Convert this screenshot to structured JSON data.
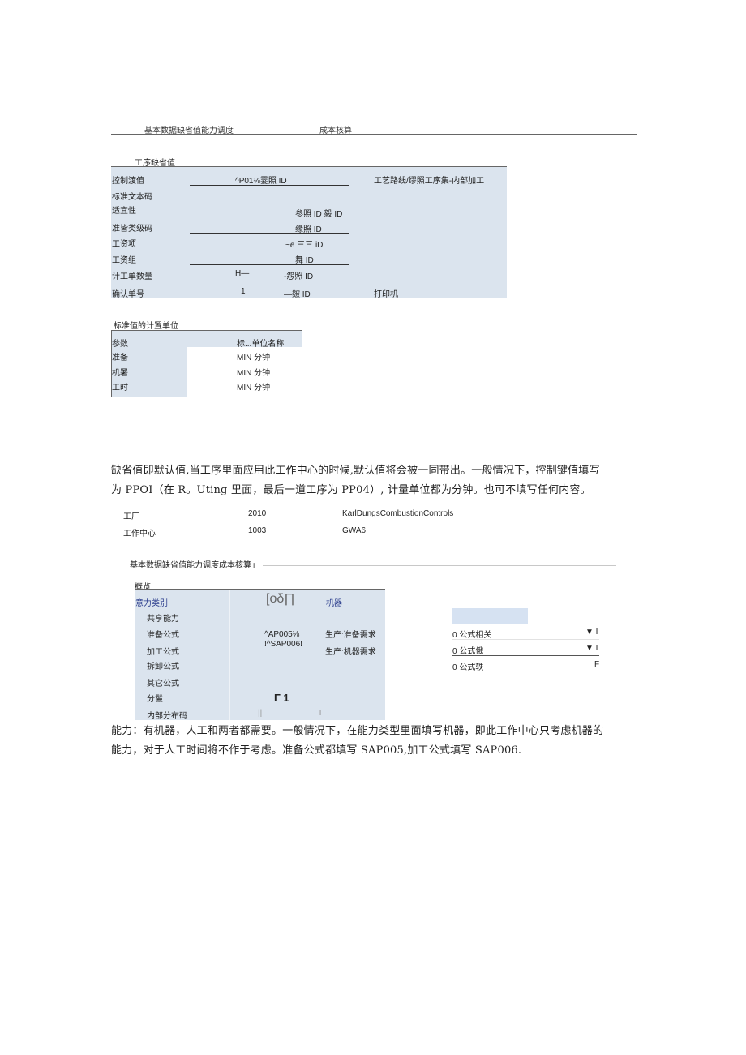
{
  "top_tabs": {
    "tab1": "基本数据缺省值能力调度",
    "tab2": "成本核算"
  },
  "operation_defaults": {
    "section_title": "工序缺省值",
    "rows": [
      {
        "label": "控制渡值",
        "value": "^P01⅛霎照 ID",
        "right": "工艺路线/缪照工序集-内部加工"
      },
      {
        "label": "标准文本码",
        "value": "",
        "right": ""
      },
      {
        "label": "适宜性",
        "value": "参照 ID 毅 ID",
        "right": ""
      },
      {
        "label": "准皆类级码",
        "value": "缘照 ID",
        "right": ""
      },
      {
        "label": "工资项",
        "value": "~e 三三 iD",
        "right": ""
      },
      {
        "label": "工资组",
        "value": "舞 ID",
        "right": ""
      },
      {
        "label": "计工单数量",
        "value_a": "H—",
        "value": "-怨照 ID",
        "right": ""
      },
      {
        "label": "确认单号",
        "value_a": "1",
        "value": "—皴 ID",
        "right": "打印机"
      }
    ]
  },
  "units_table": {
    "section_title": "标准值的计置单位",
    "headers": [
      "参数",
      "标...单位名称"
    ],
    "rows": [
      {
        "param": "准备",
        "unit": "MIN 分钟"
      },
      {
        "param": "机署",
        "unit": "MIN 分钟"
      },
      {
        "param": "工时",
        "unit": "MIN 分钟"
      }
    ]
  },
  "paragraph1": {
    "line1": "缺省值即默认值,当工序里面应用此工作中心的时候,默认值将会被一同带出。一般情况下，控制键值填写",
    "line2": "为 PPOI（在 R。Uting 里面，最后一道工序为 PP04）, 计量单位都为分钟。也可不填写任何内容。"
  },
  "header_info": {
    "plant_label": "工厂",
    "plant_code": "2010",
    "plant_name": "KarlDungsCombustionControls",
    "wc_label": "工作中心",
    "wc_code": "1003",
    "wc_name": "GWA6"
  },
  "tabs2": {
    "label": "基本数据缺省值能力调度成本核算」"
  },
  "overview": {
    "section_title": "概览",
    "capacity_type_label": "意力类别",
    "capacity_type_code": "[oδ∏",
    "capacity_type_value": "机器",
    "rows": [
      {
        "label": "共享能力",
        "value": "",
        "desc": ""
      },
      {
        "label": "准备公式",
        "value": "^AP005⅛",
        "desc": "生产:准备需求"
      },
      {
        "label": "加工公式",
        "value": "!^SAP006!",
        "desc": "生产:机器需求"
      },
      {
        "label": "拆卸公式",
        "value": "",
        "desc": ""
      },
      {
        "label": "其它公式",
        "value": "",
        "desc": ""
      },
      {
        "label": "分鬣",
        "value": "Γ 1",
        "desc": ""
      },
      {
        "label": "内部分布码",
        "value": "||",
        "value2": "T",
        "desc": ""
      }
    ]
  },
  "formula_side": {
    "rows": [
      {
        "label": "0 公式相关",
        "mark": "▼ I"
      },
      {
        "label": "0 公式俄",
        "mark": "▼ I"
      },
      {
        "label": "0 公式轶",
        "mark": "F"
      }
    ]
  },
  "paragraph2": {
    "line1": "能力：有机器，人工和两者都需要。一般情况下，在能力类型里面填写机器，即此工作中心只考虑机器的",
    "line2": "能力，对于人工时间将不作于考虑。准备公式都填写 SAP005,加工公式填写 SAP006."
  }
}
